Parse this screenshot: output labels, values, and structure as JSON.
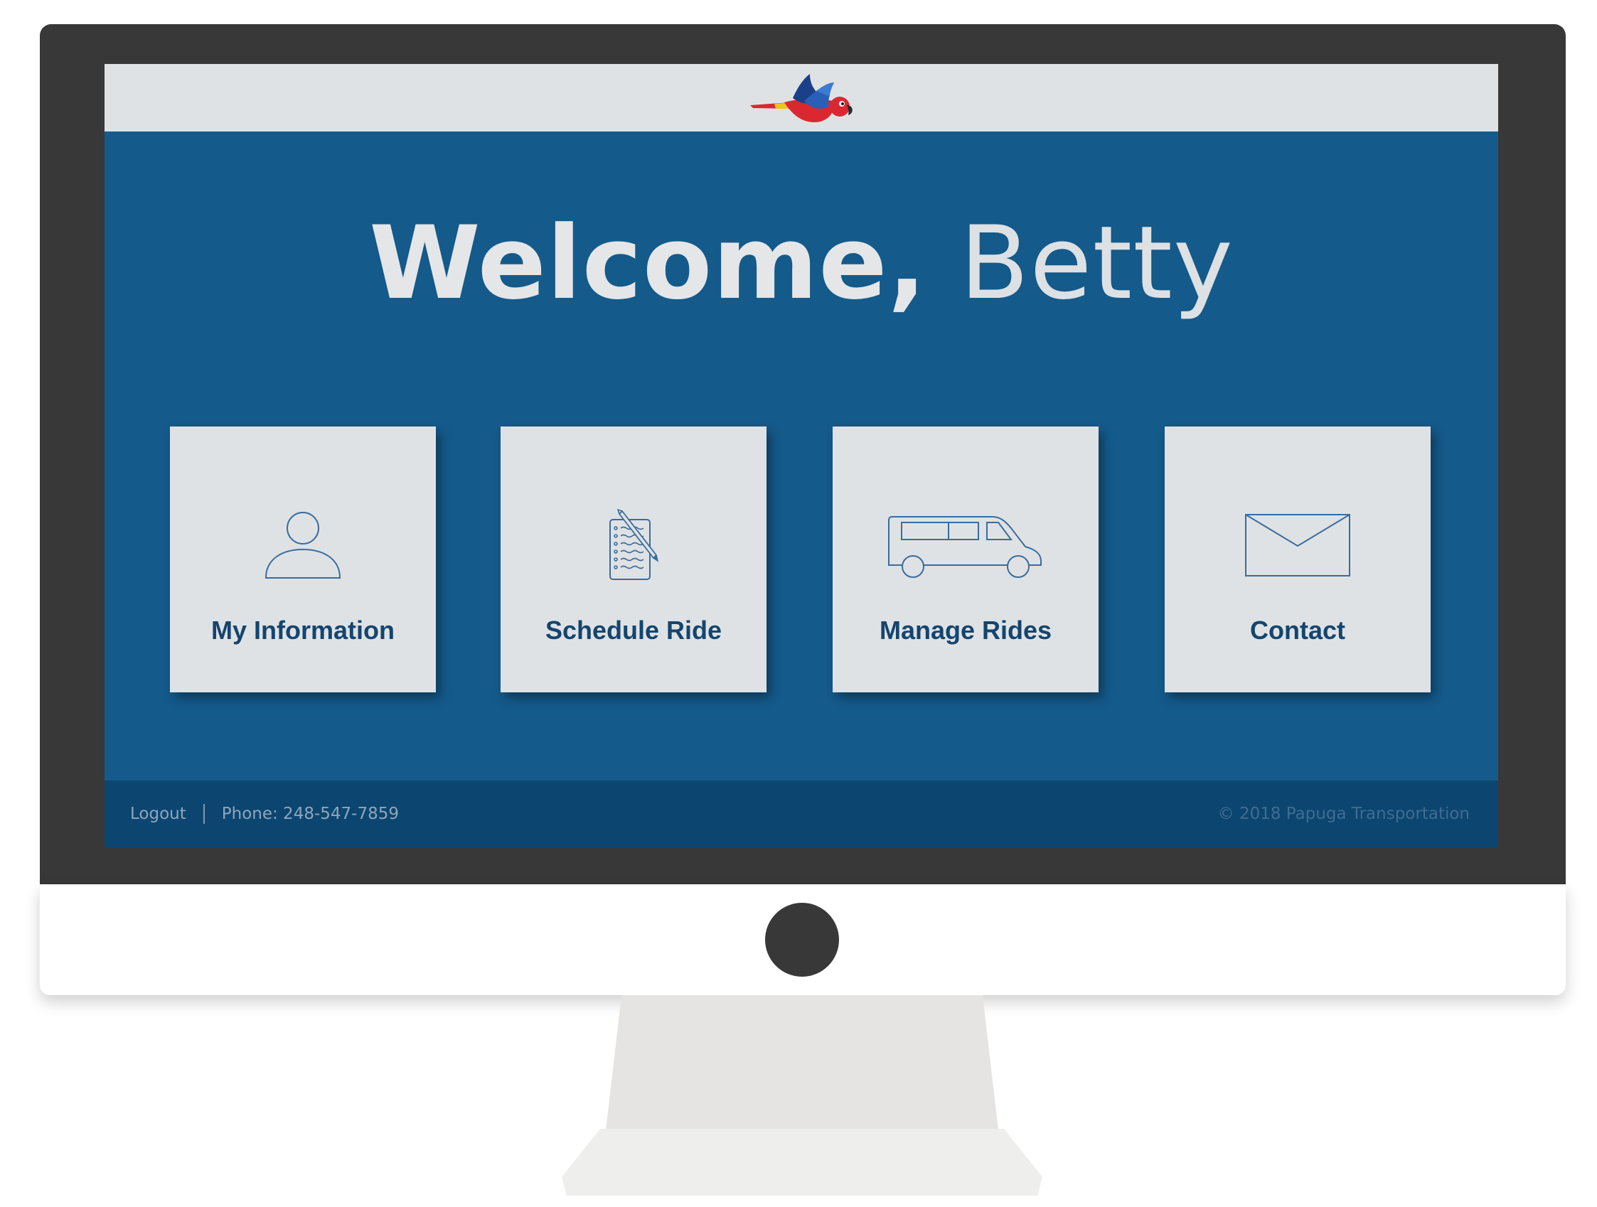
{
  "header": {
    "logo_icon": "parrot-logo-icon"
  },
  "welcome": {
    "greeting": "Welcome,",
    "name": "Betty"
  },
  "tiles": [
    {
      "label": "My Information",
      "icon": "person-icon"
    },
    {
      "label": "Schedule Ride",
      "icon": "notepad-pencil-icon"
    },
    {
      "label": "Manage Rides",
      "icon": "van-icon"
    },
    {
      "label": "Contact",
      "icon": "envelope-icon"
    }
  ],
  "footer": {
    "logout": "Logout",
    "phone": "Phone: 248-547-7859",
    "copyright": "© 2018 Papuga Transportation"
  },
  "colors": {
    "screen_bg": "#145a8b",
    "top_bar_bg": "#dfe2e4",
    "tile_bg": "#dfe2e4",
    "tile_text": "#14456f",
    "footer_bg": "#0c4670",
    "bezel": "#383838"
  }
}
